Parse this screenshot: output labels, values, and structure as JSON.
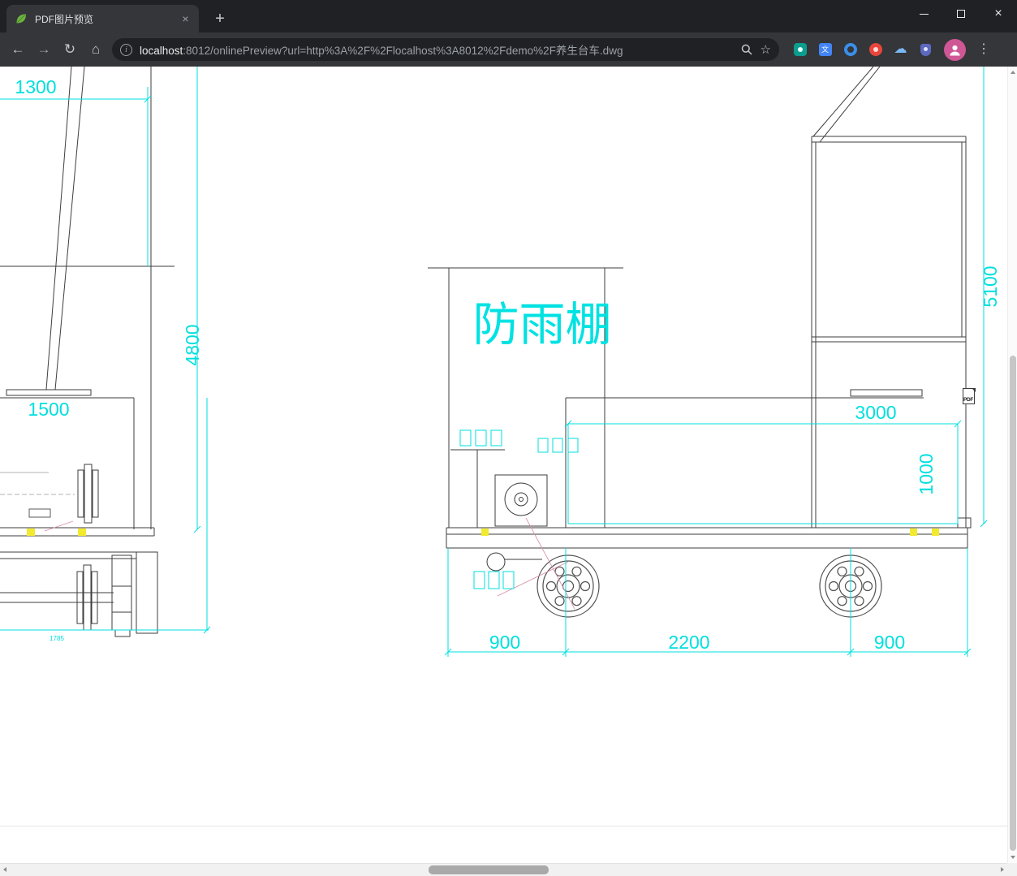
{
  "colors": {
    "dimension_cyan": "#00dfdf",
    "drawing_line": "#3d3d3d",
    "highlight_yellow": "#f2ea2e",
    "leader_pink": "#d98fa9",
    "chrome_frame": "#202124",
    "chrome_toolbar": "#35363a"
  },
  "titlebar": {
    "tab_title": "PDF图片预览"
  },
  "toolbar": {
    "url_host": "localhost",
    "url_tail": ":8012/onlinePreview?url=http%3A%2F%2Flocalhost%3A8012%2Fdemo%2F养生台车.dwg"
  },
  "icons": {
    "back": "←",
    "forward": "→",
    "reload": "↻",
    "home": "⌂",
    "info": "i",
    "star": "☆",
    "menu_dots": "⋮",
    "new_tab": "+",
    "tab_close": "×",
    "window_close": "×",
    "cloud": "☁",
    "translate": "文"
  },
  "drawing": {
    "shelter_label": "防雨棚",
    "pdf_badge": "PDF",
    "dims": {
      "top_width": "1300",
      "left_height": "4800",
      "platform_width": "1500",
      "base_small": "1785",
      "house_width": "3000",
      "house_height": "1000",
      "frame_height": "5100",
      "front_overhang": "900",
      "wheel_base": "2200",
      "rear_overhang": "900"
    }
  }
}
